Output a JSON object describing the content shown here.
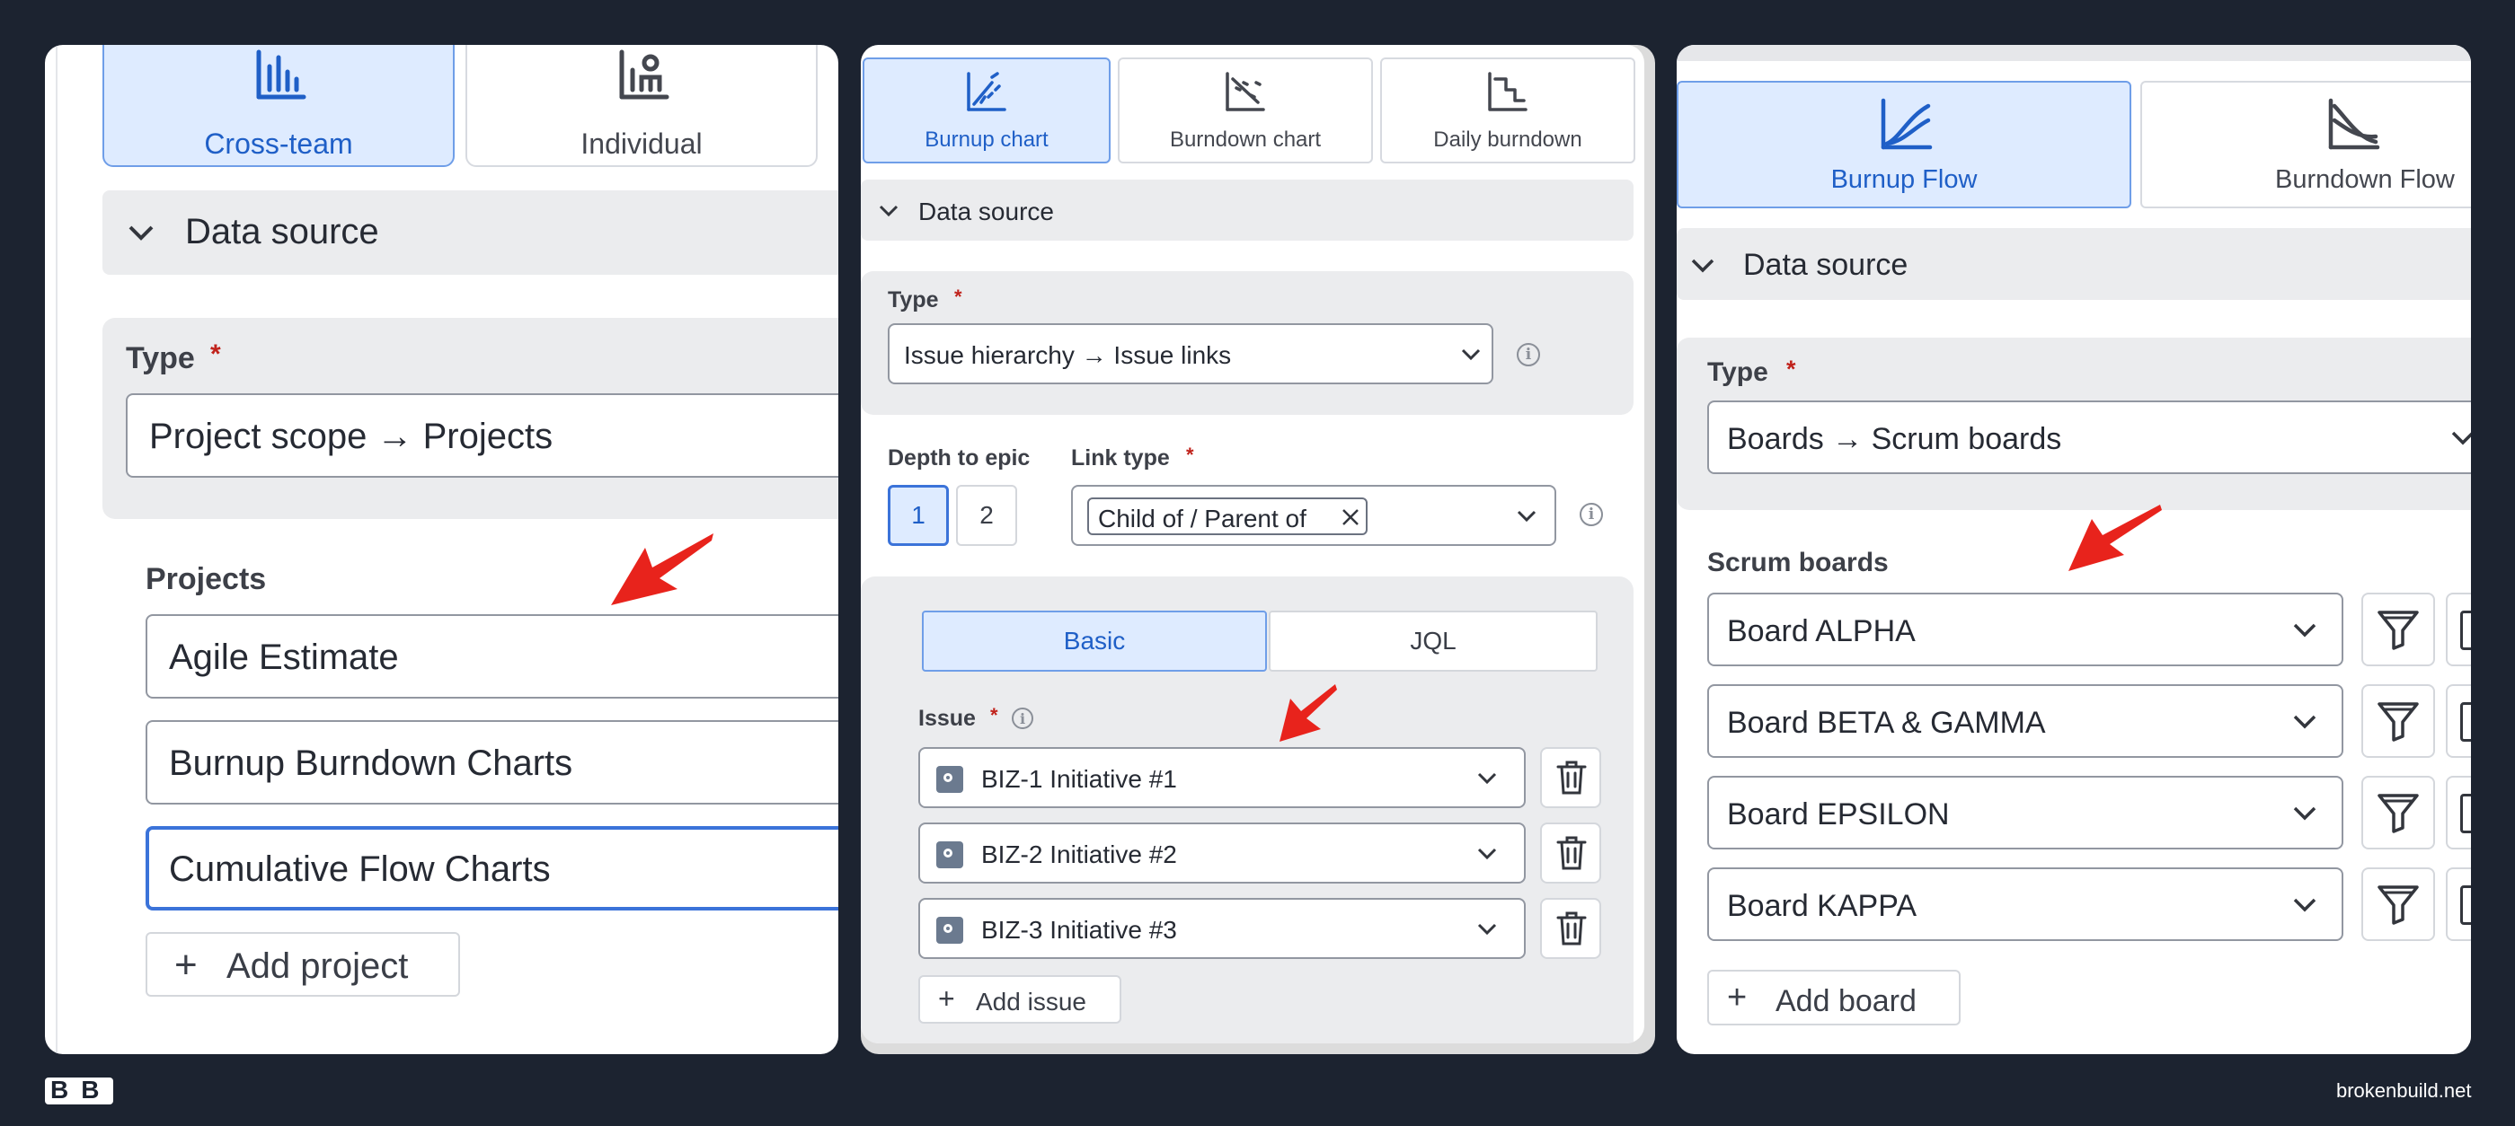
{
  "panel1": {
    "tabs": [
      {
        "label": "Cross-team",
        "selected": true,
        "icon": "bar-chart-icon"
      },
      {
        "label": "Individual",
        "selected": false,
        "icon": "person-chart-icon"
      }
    ],
    "section_title": "Data source",
    "type_label": "Type",
    "required_mark": "*",
    "type_value": "Project scope → Projects",
    "projects_label": "Projects",
    "projects": [
      "Agile Estimate",
      "Burnup Burndown Charts",
      "Cumulative Flow Charts"
    ],
    "add_button": "Add project"
  },
  "panel2": {
    "tabs": [
      {
        "label": "Burnup chart",
        "selected": true,
        "icon": "burnup-chart-icon"
      },
      {
        "label": "Burndown chart",
        "selected": false,
        "icon": "burndown-chart-icon"
      },
      {
        "label": "Daily burndown",
        "selected": false,
        "icon": "daily-burndown-icon"
      }
    ],
    "section_title": "Data source",
    "type_label": "Type",
    "required_mark": "*",
    "type_value": "Issue hierarchy → Issue links",
    "depth_label": "Depth to epic",
    "depth_options": [
      "1",
      "2"
    ],
    "depth_selected": "1",
    "link_type_label": "Link type",
    "link_type_tag": "Child of / Parent of",
    "mode_tabs": [
      {
        "label": "Basic",
        "selected": true
      },
      {
        "label": "JQL",
        "selected": false
      }
    ],
    "issue_label": "Issue",
    "issues": [
      "BIZ-1 Initiative #1",
      "BIZ-2 Initiative #2",
      "BIZ-3 Initiative #3"
    ],
    "add_button": "Add issue"
  },
  "panel3": {
    "tabs": [
      {
        "label": "Burnup Flow",
        "selected": true,
        "icon": "burnup-flow-icon"
      },
      {
        "label": "Burndown Flow",
        "selected": false,
        "icon": "burndown-flow-icon"
      }
    ],
    "section_title": "Data source",
    "type_label": "Type",
    "required_mark": "*",
    "type_value": "Boards → Scrum boards",
    "boards_label": "Scrum boards",
    "boards": [
      "Board ALPHA",
      "Board BETA & GAMMA",
      "Board EPSILON",
      "Board KAPPA"
    ],
    "add_button": "Add board"
  },
  "footer": {
    "logo_text": "BB",
    "site": "brokenbuild.net"
  },
  "colors": {
    "background": "#1c2330",
    "selected_fill": "#deebff",
    "selected_text": "#1f5fc7",
    "focus_border": "#3b73d9",
    "arrow": "#e8231c",
    "required": "#c0221b"
  }
}
